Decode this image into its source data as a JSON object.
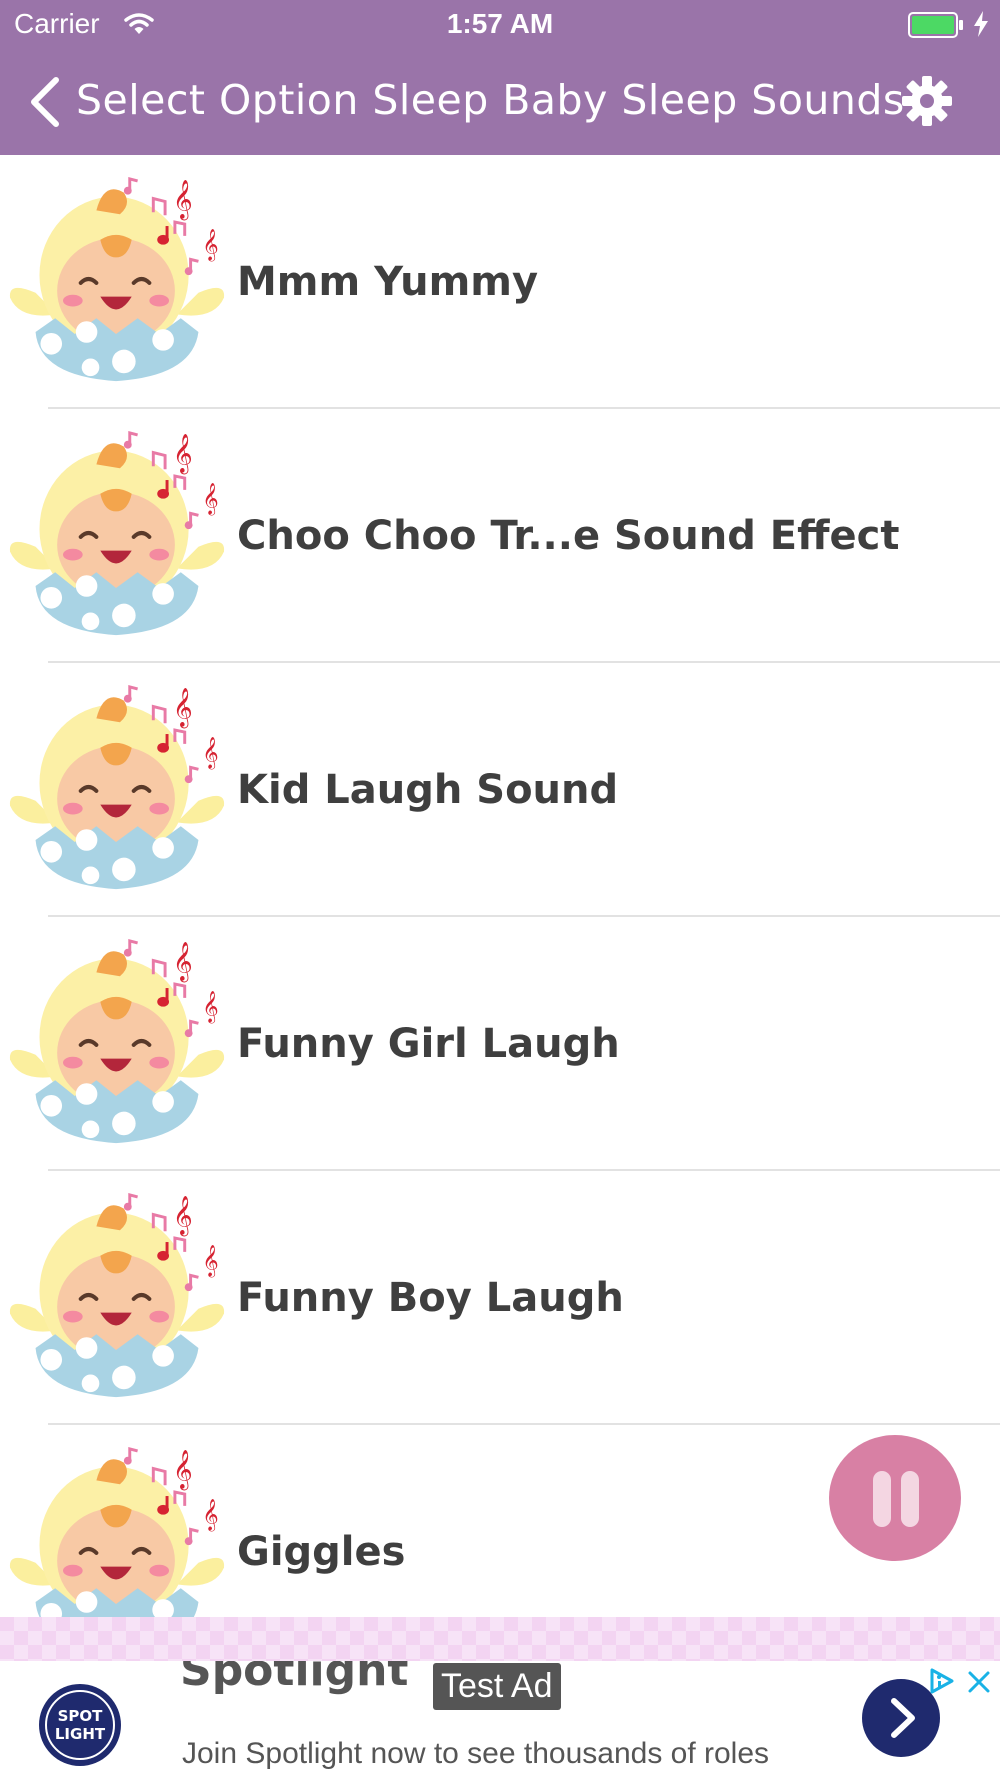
{
  "status_bar": {
    "carrier": "Carrier",
    "time": "1:57 AM"
  },
  "nav": {
    "back_icon": "chevron-left-icon",
    "title": "Select Option Sleep Baby Sleep Sounds",
    "settings_icon": "gear-icon"
  },
  "colors": {
    "header": "#9a74a9",
    "label_text": "#3f3f3f",
    "pause_button": "#d880a4",
    "ad_cta": "#1f2a6e",
    "battery": "#4cd964"
  },
  "sounds": [
    {
      "label": "Mmm Yummy"
    },
    {
      "label": "Choo Choo Tr...e Sound Effect"
    },
    {
      "label": "Kid Laugh Sound"
    },
    {
      "label": "Funny Girl Laugh"
    },
    {
      "label": "Funny Boy Laugh"
    },
    {
      "label": "Giggles"
    }
  ],
  "player": {
    "state_icon": "pause-icon"
  },
  "ad": {
    "headline": "Spotlight",
    "badge": "Test Ad",
    "body": "Join Spotlight now to see thousands of roles",
    "logo_text": "SPOTLIGHT",
    "cta_icon": "chevron-right-icon",
    "adchoices_icon": "adchoices-icon",
    "close_icon": "close-icon"
  }
}
